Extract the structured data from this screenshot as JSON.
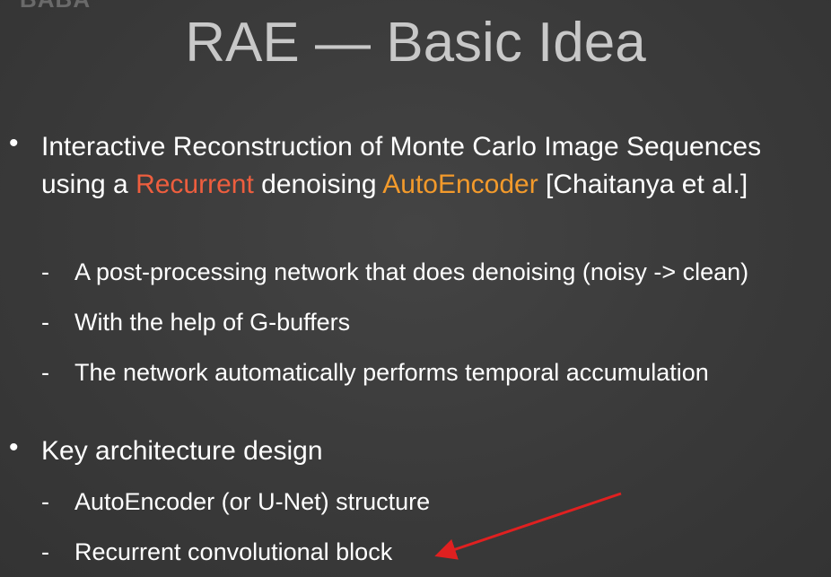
{
  "watermark": "BABA",
  "title": "RAE — Basic Idea",
  "bullets": [
    {
      "part1": "Interactive Reconstruction of Monte Carlo Image Sequences using a ",
      "highlight1": "Recurrent",
      "part2": " denoising ",
      "highlight2": "AutoEncoder",
      "part3": " [Chaitanya et al.]",
      "subitems": [
        "A post-processing network that does denoising (noisy -> clean)",
        "With the help of G-buffers",
        "The network automatically performs temporal accumulation"
      ]
    },
    {
      "text": "Key architecture design",
      "subitems": [
        "AutoEncoder (or U-Net) structure",
        "Recurrent convolutional block"
      ]
    }
  ],
  "bullet_symbol": "•",
  "dash_symbol": "-",
  "colors": {
    "background": "#3a3a3a",
    "title": "#c8c8c8",
    "recurrent": "#ee5e3e",
    "autoencoder": "#f39a2b",
    "annotation_arrow": "#e02020"
  },
  "annotation": {
    "type": "arrow",
    "points_to": "Recurrent convolutional block"
  }
}
